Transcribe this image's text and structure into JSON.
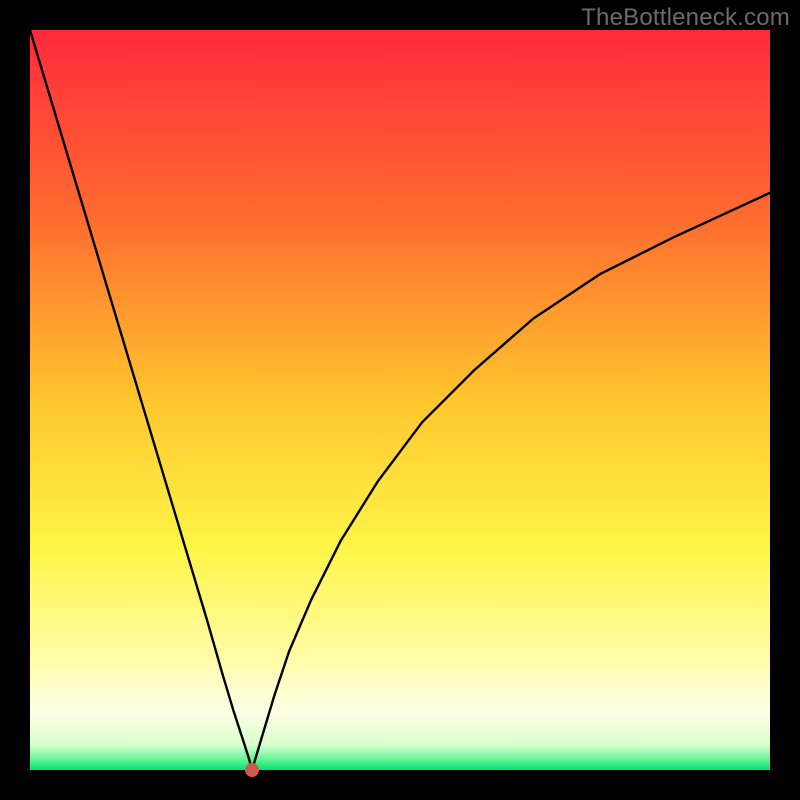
{
  "watermark": "TheBottleneck.com",
  "chart_data": {
    "type": "line",
    "title": "",
    "xlabel": "",
    "ylabel": "",
    "xlim": [
      0,
      100
    ],
    "ylim": [
      0,
      100
    ],
    "curve_min_x": 30,
    "green_band_height_pct": 3,
    "marker": {
      "x": 30,
      "y": 0
    },
    "gradient_stops": [
      {
        "offset": 0.0,
        "color": "#ff2a3d"
      },
      {
        "offset": 0.25,
        "color": "#ff6a2f"
      },
      {
        "offset": 0.5,
        "color": "#ffc62e"
      },
      {
        "offset": 0.7,
        "color": "#fff547"
      },
      {
        "offset": 0.85,
        "color": "#fffca8"
      },
      {
        "offset": 0.92,
        "color": "#ffffe6"
      },
      {
        "offset": 0.965,
        "color": "#d9ffcf"
      },
      {
        "offset": 0.985,
        "color": "#6bf59a"
      },
      {
        "offset": 1.0,
        "color": "#00e371"
      }
    ],
    "series": [
      {
        "name": "bottleneck-curve",
        "x": [
          0,
          3,
          6,
          9,
          12,
          15,
          18,
          21,
          24,
          26,
          27.5,
          28.8,
          29.6,
          30,
          30.6,
          31.5,
          33,
          35,
          38,
          42,
          47,
          53,
          60,
          68,
          77,
          87,
          100
        ],
        "y": [
          100,
          90,
          80,
          70,
          60,
          50,
          40,
          30,
          20,
          13,
          8,
          4,
          1.5,
          0,
          2,
          5,
          10,
          16,
          23,
          31,
          39,
          47,
          54,
          61,
          67,
          72,
          78
        ]
      }
    ]
  }
}
